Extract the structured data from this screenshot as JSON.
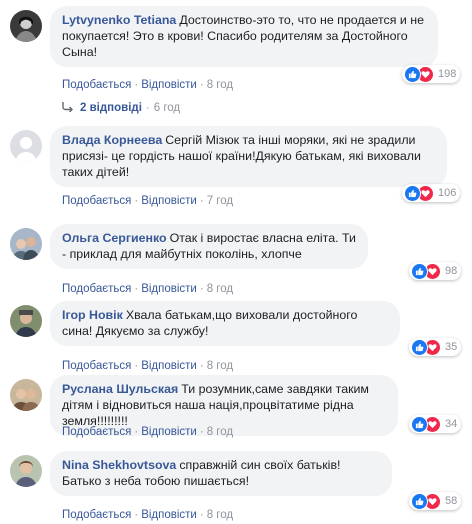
{
  "actions": {
    "like_label": "Подобається",
    "reply_label": "Відповісти",
    "separator": "·"
  },
  "replies_link": {
    "label": "2 відповіді",
    "time": "6 год"
  },
  "comments": [
    {
      "author": "Lytvynenko Tetiana",
      "text": "Достоинство-это то, что не продается и не покупается! Это в крови! Спасибо родителям за Достойного Сына!",
      "time": "8 год",
      "reactions": "198"
    },
    {
      "author": "Влада Корнеева",
      "text": "Сергій Мізюк та інші моряки, які не зрадили присязі- це гордість нашої країни!Дякую батькам, які виховали таких дітей!",
      "time": "7 год",
      "reactions": "106"
    },
    {
      "author": "Ольга Сергиенко",
      "text": "Отак і виростає власна еліта. Ти - приклад для майбутніх поколінь, хлопче",
      "time": "8 год",
      "reactions": "98"
    },
    {
      "author": "Ігор Новік",
      "text": "Хвала батькам,що виховали достойного сина! Дякуємо за службу!",
      "time": "8 год",
      "reactions": "35"
    },
    {
      "author": "Руслана Шульская",
      "text": "Ти розумник,саме завдяки таким дітям і відновиться наша нація,процвітатиме рідна земля!!!!!!!!!",
      "time": "8 год",
      "reactions": "34"
    },
    {
      "author": "Nina Shekhovtsova",
      "text": "справжній син своїх батьків! Батько з неба тобою пишається!",
      "time": "8 год",
      "reactions": "58"
    }
  ]
}
